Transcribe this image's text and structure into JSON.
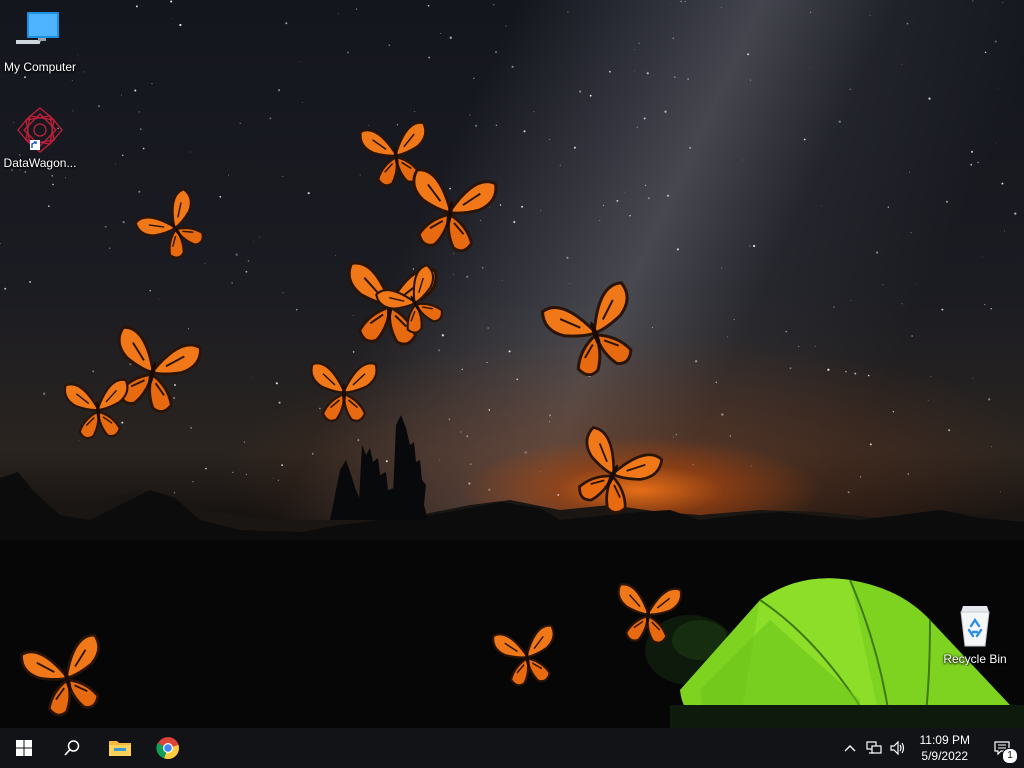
{
  "desktop": {
    "icons": [
      {
        "label": "My Computer",
        "icon": "computer-icon"
      },
      {
        "label": "DataWagon...",
        "icon": "datawagon-shortcut-icon"
      },
      {
        "label": "Recycle Bin",
        "icon": "recycle-bin-icon"
      }
    ],
    "wallpaper": "night-sky-tent-wallpaper",
    "overlay": "monarch-butterflies"
  },
  "taskbar": {
    "start_icon": "windows-start-icon",
    "search_icon": "search-icon",
    "pinned": [
      {
        "name": "File Explorer",
        "icon": "file-explorer-icon"
      },
      {
        "name": "Google Chrome",
        "icon": "chrome-icon"
      }
    ],
    "tray_icons": [
      "chevron-up-icon",
      "network-icon",
      "volume-icon"
    ],
    "clock": {
      "time": "11:09 PM",
      "date": "5/9/2022"
    },
    "notification_count": "1"
  },
  "colors": {
    "taskbar_bg": "#121317",
    "butterfly_orange": "#f07818",
    "tent_green": "#7ed321"
  }
}
